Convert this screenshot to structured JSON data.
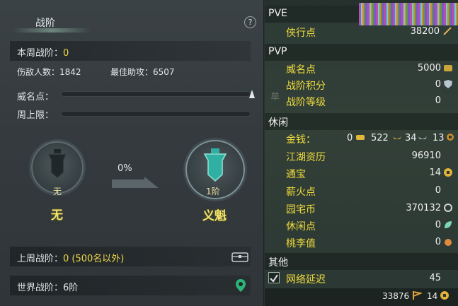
{
  "left": {
    "title": "战阶",
    "help_icon": "?",
    "week_label": "本周战阶：",
    "week_value": "0",
    "kills_label": "伤敌人数：",
    "kills_value": "1842",
    "assist_label": "最佳助攻：",
    "assist_value": "6507",
    "prestige_label": "威名点：",
    "cap_label": "周上限：",
    "current_badge_sub": "无",
    "current_rank": "无",
    "progress_text": "0%",
    "next_badge_sub": "1阶",
    "next_rank": "义魁",
    "last_week_label": "上周战阶：",
    "last_week_value": "0 (500名以外)",
    "world_label": "世界战阶：",
    "world_value": "6阶"
  },
  "right": {
    "pve_header": "PVE",
    "pvp_header": "PVP",
    "leisure_header": "休闲",
    "other_header": "其他",
    "ghost_text": "单",
    "items": {
      "xiaxing": {
        "label": "侠行点",
        "value": "38200"
      },
      "weiming": {
        "label": "威名点",
        "value": "5000"
      },
      "zhanjie_jifen": {
        "label": "战阶积分",
        "value": "0"
      },
      "zhanjie_dengji": {
        "label": "战阶等级",
        "value": "0"
      },
      "money": {
        "label": "金钱：",
        "v1": "0",
        "v2": "522",
        "v3": "34",
        "v4": "13"
      },
      "jianghu": {
        "label": "江湖资历",
        "value": "96910"
      },
      "tongbao": {
        "label": "通宝",
        "value": "14"
      },
      "xinhuo": {
        "label": "薪火点",
        "value": "0"
      },
      "yuanzhai": {
        "label": "园宅币",
        "value": "370132"
      },
      "xiuxian": {
        "label": "休闲点",
        "value": "0"
      },
      "taoli": {
        "label": "桃李值",
        "value": "0"
      },
      "latency": {
        "label": "网络延迟",
        "value": "45"
      }
    },
    "footer": {
      "value1": "33876",
      "value2": "14"
    }
  },
  "colors": {
    "accent_yellow": "#f0dc3c",
    "rank_yellow": "#f3e56b"
  }
}
